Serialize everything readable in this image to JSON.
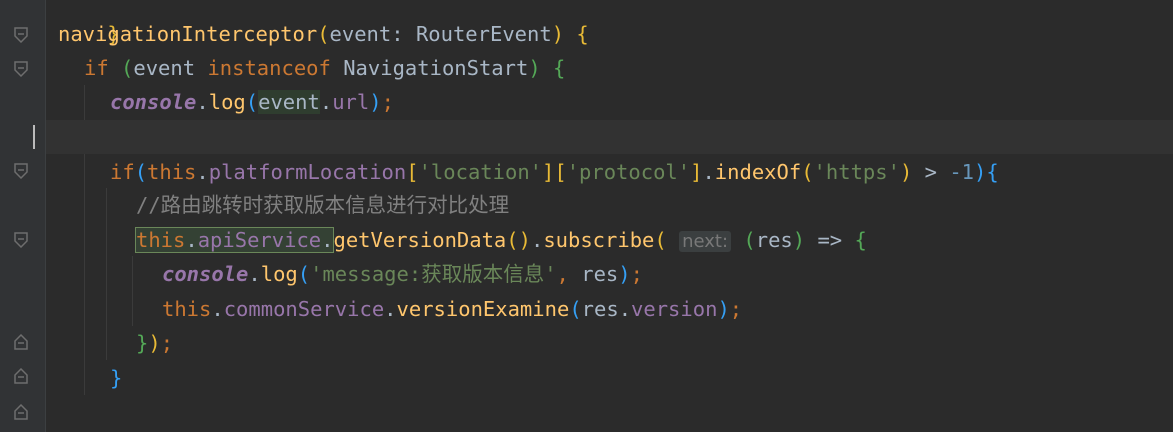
{
  "colors": {
    "background": "#2b2b2b",
    "gutter": "#313335",
    "keyword": "#cc7832",
    "function": "#ffc66d",
    "property": "#9876aa",
    "string": "#6a8759",
    "number": "#6897bb",
    "comment": "#808080",
    "text": "#a9b7c6"
  },
  "code": {
    "l0": {
      "brace": "}"
    },
    "l1": {
      "fn": "navigationInterceptor",
      "open": "(",
      "param": "event",
      "colon": ": ",
      "type": "RouterEvent",
      "close": ")",
      "brace": " {"
    },
    "l2": {
      "kw": "if",
      "open": " (",
      "var": "event ",
      "kw2": "instanceof",
      "type": " NavigationStart",
      "close": ")",
      "brace": " {"
    },
    "l3": {
      "obj": "console",
      "dot": ".",
      "fn": "log",
      "open": "(",
      "arg": "event",
      "dot2": ".",
      "prop": "url",
      "close": ")",
      "semi": ";"
    },
    "l5": {
      "kw": "if",
      "open": "(",
      "this": "this",
      "dot": ".",
      "prop": "platformLocation",
      "b1": "[",
      "s1": "'location'",
      "b2": "][",
      "s2": "'protocol'",
      "b3": "]",
      "dot2": ".",
      "fn": "indexOf",
      "open2": "(",
      "s3": "'https'",
      "close2": ")",
      "op": " > ",
      "num": "-1",
      "close": ")",
      "brace": "{"
    },
    "l6": {
      "comment": "//路由跳转时获取版本信息进行对比处理"
    },
    "l7": {
      "this": "this",
      "dot": ".",
      "prop": "apiService",
      "dot2": ".",
      "fn": "getVersionData",
      "call": "()",
      "dot3": ".",
      "fn2": "subscribe",
      "open": "(",
      "hint": "next:",
      "open2": " (",
      "param": "res",
      "close2": ")",
      "arrow": " => ",
      "brace": "{"
    },
    "l8": {
      "obj": "console",
      "dot": ".",
      "fn": "log",
      "open": "(",
      "str": "'message:获取版本信息'",
      "comma": ", ",
      "arg": "res",
      "close": ")",
      "semi": ";"
    },
    "l9": {
      "this": "this",
      "dot": ".",
      "prop": "commonService",
      "dot2": ".",
      "fn": "versionExamine",
      "open": "(",
      "arg": "res",
      "dot3": ".",
      "prop2": "version",
      "close": ")",
      "semi": ";"
    },
    "l10": {
      "brace": "}",
      "close": ")",
      "semi": ";"
    },
    "l11": {
      "brace": "}"
    }
  }
}
